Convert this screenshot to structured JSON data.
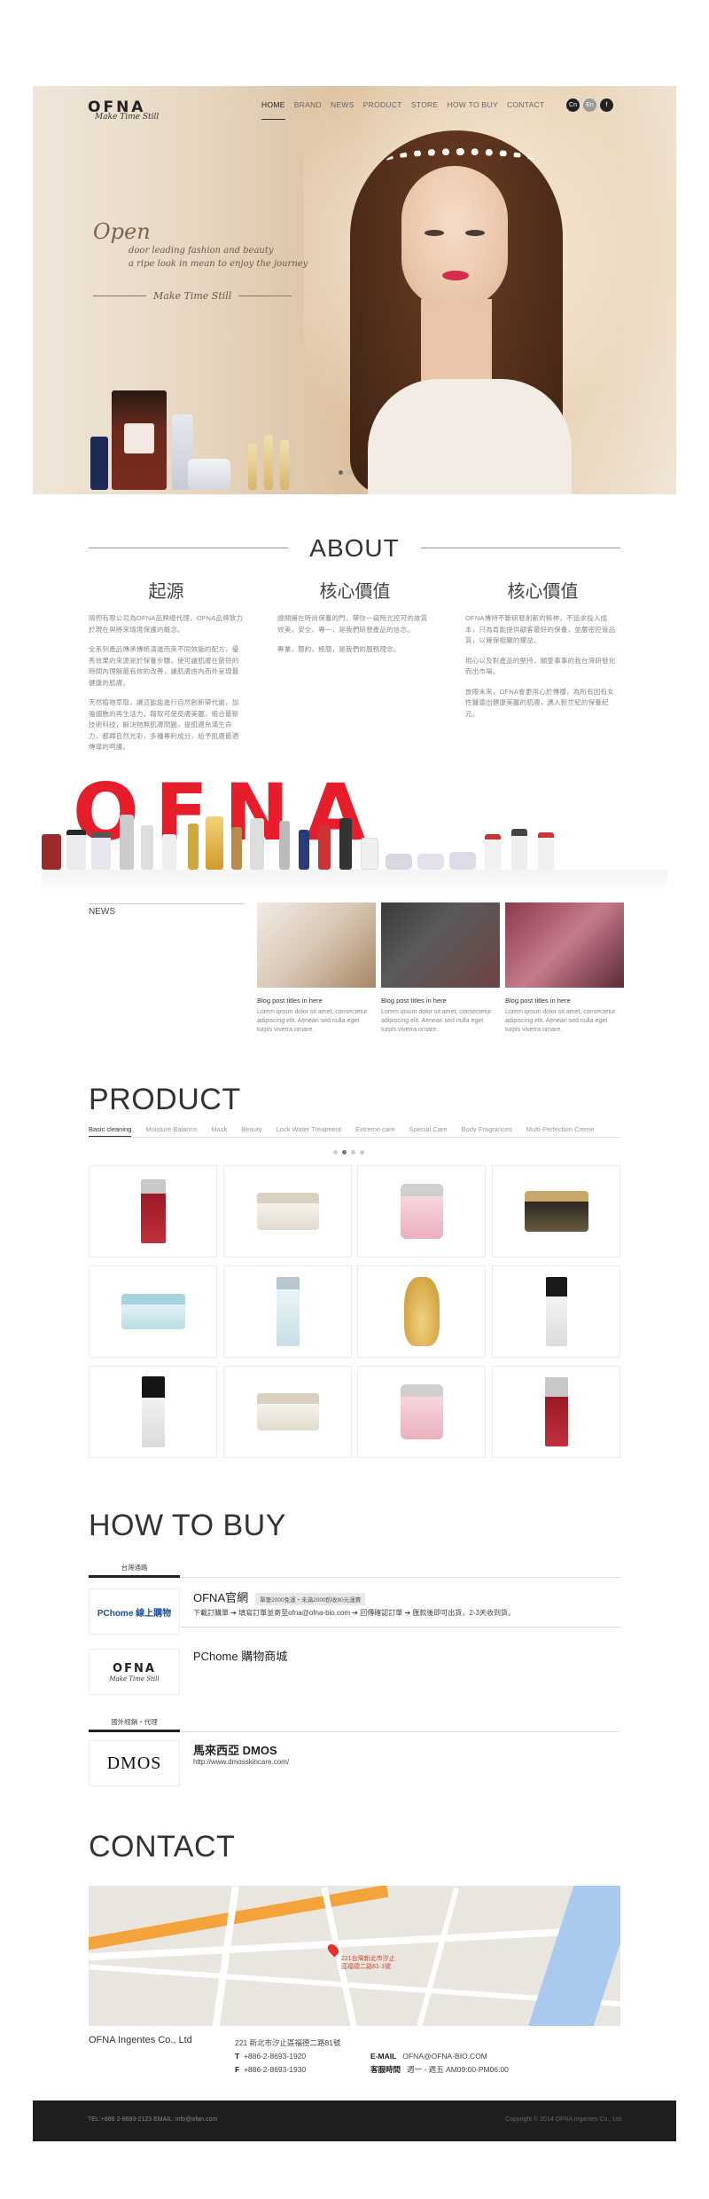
{
  "nav": {
    "logo": "OFNA",
    "logo_sub": "Make Time Still",
    "items": [
      "HOME",
      "BRAND",
      "NEWS",
      "PRODUCT",
      "STORE",
      "HOW TO BUY",
      "CONTACT"
    ],
    "lang": [
      "Cn",
      "En",
      "f"
    ]
  },
  "hero": {
    "open": "Open",
    "line1": "door leading fashion and beauty",
    "line2": "a ripe look in mean to enjoy the journey",
    "make": "Make Time Still"
  },
  "about": {
    "title": "ABOUT",
    "columns": [
      {
        "heading": "起源",
        "paras": [
          "晴煦有限公司為OFNA品牌總代理，OFNA品牌致力於現在與將來環境保護的概念。",
          "全系列產品傳承傳統演進而來不同效能的配方，優秀效果的來源是於保養步驟，使可讓肌膚在最短的時間內理解最有效的改善，讓肌膚由內而外呈現最健康的肌膚。",
          "天然植物萃取，讓這能能進行自然創新帶代謝，加強細胞的再生活力，藉取可使皮膚美麗，組合最新技術科技，解決物無肌膚問題，提肌膚充滿生命力，都歸自然光彩，多種專利成分，給予肌膚最適傳導的呵護。"
        ]
      },
      {
        "heading": "核心價值",
        "paras": [
          "證開擁在時尚保養的門，帶你一窺時光控可的故質效美，安全、專一，是我們研發產品的信念。",
          "專業，簡約，極簡，是我們的服務理念。"
        ]
      },
      {
        "heading": "核心價值",
        "paras": [
          "OFNA傳持不斷研發創新的精神，不追求投入成本，只為肯能提供顧客最好的保養，並嚴密控管品質，以確保相關的權益。",
          "用心以及對產品的堅持，關愛事事的我台灣研發化而出市場。",
          "放眼未來，OFNA會更用心於傳播，為所有因有女性醫德出健康美麗的肌膚，邁入新世紀的保養紀元。"
        ]
      }
    ]
  },
  "banner": {
    "logo": "OFNA"
  },
  "news": {
    "label": "NEWS",
    "posts": [
      {
        "title": "Blog post titles in here",
        "desc": "Lorem ipsum dolor sit amet, consectetur adipiscing elit. Aenean sed nulla eget turpis viverra ornare."
      },
      {
        "title": "Blog post titles in here",
        "desc": "Lorem ipsum dolor sit amet, consectetur adipiscing elit. Aenean sed nulla eget turpis viverra ornare."
      },
      {
        "title": "Blog post titles in here",
        "desc": "Lorem ipsum dolor sit amet, consectetur adipiscing elit. Aenean sed nulla eget turpis viverra ornare."
      }
    ]
  },
  "product": {
    "title": "PRODUCT",
    "tabs": [
      "Basic cleaning",
      "Moisture Balance",
      "Mask",
      "Beauty",
      "Lock Water Treatment",
      "Extreme care",
      "Special Care",
      "Body Fragrances",
      "Multi-Perfection Creme"
    ]
  },
  "buy": {
    "title": "HOW TO BUY",
    "tag_tw": "台灣通路",
    "tag_intl": "國外經銷・代理",
    "ofna_title": "OFNA官網",
    "ofna_badge": "單筆2000免運・未滿2000酌收80元運費",
    "ofna_steps": "下載訂購單 ➔ 填寫訂單並寄至ofna@ofna-bio.com ➔ 回傳確認訂單 ➔ 匯款後即可出貨，2-3天收到貨。",
    "pchome_title": "PChome 購物商城",
    "pchome_logo": "PChome 線上購物",
    "ofna_logo": "OFNA",
    "ofna_logo_sub": "Make Time Still",
    "dmos_title": "馬來西亞  DMOS",
    "dmos_logo": "DMOS",
    "dmos_url": "http://www.dmosskincare.com/"
  },
  "contact": {
    "title": "CONTACT",
    "map_label1": "221台灣新北市汐止",
    "map_label2": "區福德二路81-1號",
    "company": "OFNA Ingentes Co., Ltd",
    "address": "221  新北市汐止區福德二路81號",
    "tel_label": "T",
    "tel": "+886-2-8693-1920",
    "fax_label": "F",
    "fax": "+886-2-8693-1930",
    "email_label": "E-MAIL",
    "email": "OFNA@OFNA-BIO.COM",
    "hours_label": "客服時間",
    "hours": "週一 - 週五 AM09:00-PM06:00"
  },
  "footer": {
    "left": "TEL:+886 2-8693-2123      EMAIL: info@ofan.com",
    "right": "Copyright © 2014 OFNA Ingentes Co., Ltd"
  },
  "colors": {
    "brand_red": "#e61e2b",
    "footer_bg": "#1e1e1e"
  }
}
